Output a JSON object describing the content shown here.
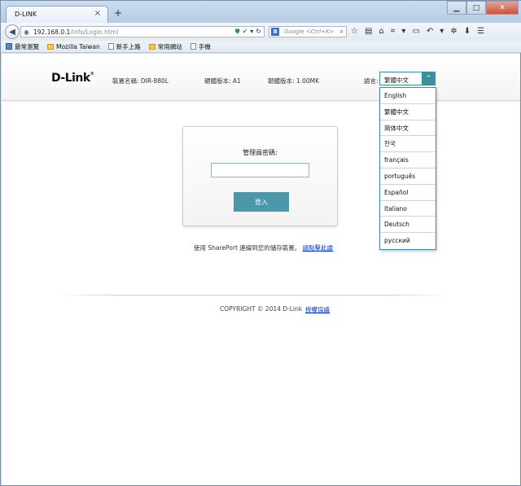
{
  "browser": {
    "tab_title": "D-LINK",
    "new_tab": "+",
    "url_host": "192.168.0.1",
    "url_path": "/info/Login.html",
    "search_engine_badge": "8",
    "search_placeholder": "Google <Ctrl+K>",
    "bookmarks": [
      "最常瀏覽",
      "Mozilla Taiwan",
      "新手上路",
      "常用網站",
      "手機"
    ]
  },
  "header": {
    "logo": "D-Link",
    "logo_mark": "®",
    "model": "裝置名稱: DIR-880L",
    "hardware": "硬體版本: A1",
    "firmware": "韌體版本: 1.00MK",
    "language_label": "語言:",
    "language_selected": "繁體中文",
    "language_options": [
      "English",
      "繁體中文",
      "简体中文",
      "한국",
      "français",
      "português",
      "Español",
      "Italiano",
      "Deutsch",
      "русский"
    ]
  },
  "login": {
    "password_label": "管理員密碼:",
    "password_value": "",
    "login_button": "登入"
  },
  "footer": {
    "shareport_text": "使用 SharePort 連線到您的儲存裝置。",
    "shareport_link": "請點擊此處",
    "copyright": "COPYRIGHT © 2014 D-Link",
    "license": "授權協議"
  },
  "colors": {
    "accent": "#4b98ad",
    "link": "#0033cc"
  },
  "icons": [
    "back-arrow-icon",
    "globe-icon",
    "shield-icon",
    "reload-icon",
    "search-icon",
    "star-icon",
    "home-icon",
    "menu-icon",
    "chevron-up-icon"
  ]
}
